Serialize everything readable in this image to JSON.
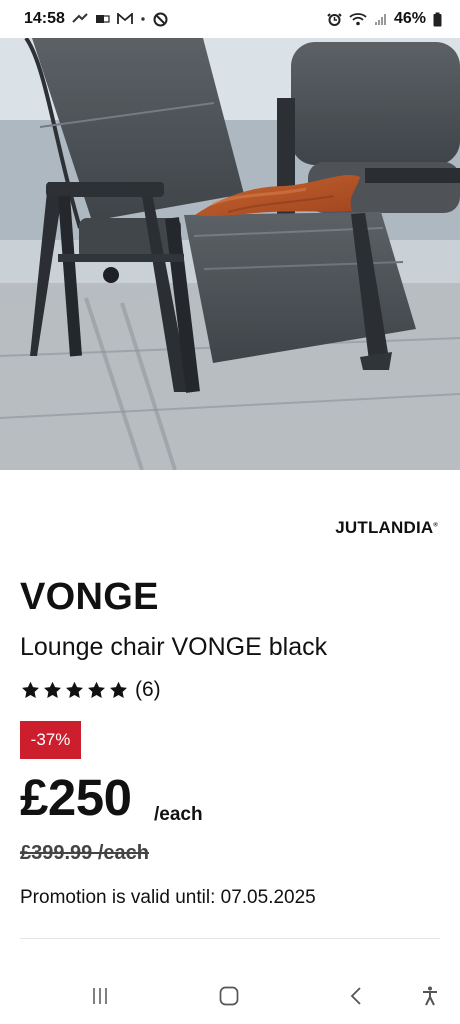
{
  "status_bar": {
    "time": "14:58",
    "battery": "46%"
  },
  "hero": {
    "image_subject": "grey reclining lounge chair with orange throw on a terrace",
    "carousel_index": 1
  },
  "product": {
    "brand": "JUTLANDIA",
    "brand_mark": "®",
    "name": "VONGE",
    "subtitle": "Lounge chair VONGE black",
    "rating": 5,
    "review_count": "(6)",
    "discount": "-37%",
    "price": "£250",
    "price_unit": "/each",
    "old_price": "£399.99 /each",
    "promotion": "Promotion is valid until: 07.05.2025"
  },
  "nav_bar": {
    "items": [
      "recent-apps",
      "home",
      "back",
      "accessibility"
    ]
  },
  "colors": {
    "discount_badge": "#cc1e2d",
    "text": "#111111",
    "divider": "#e5e5e5"
  }
}
